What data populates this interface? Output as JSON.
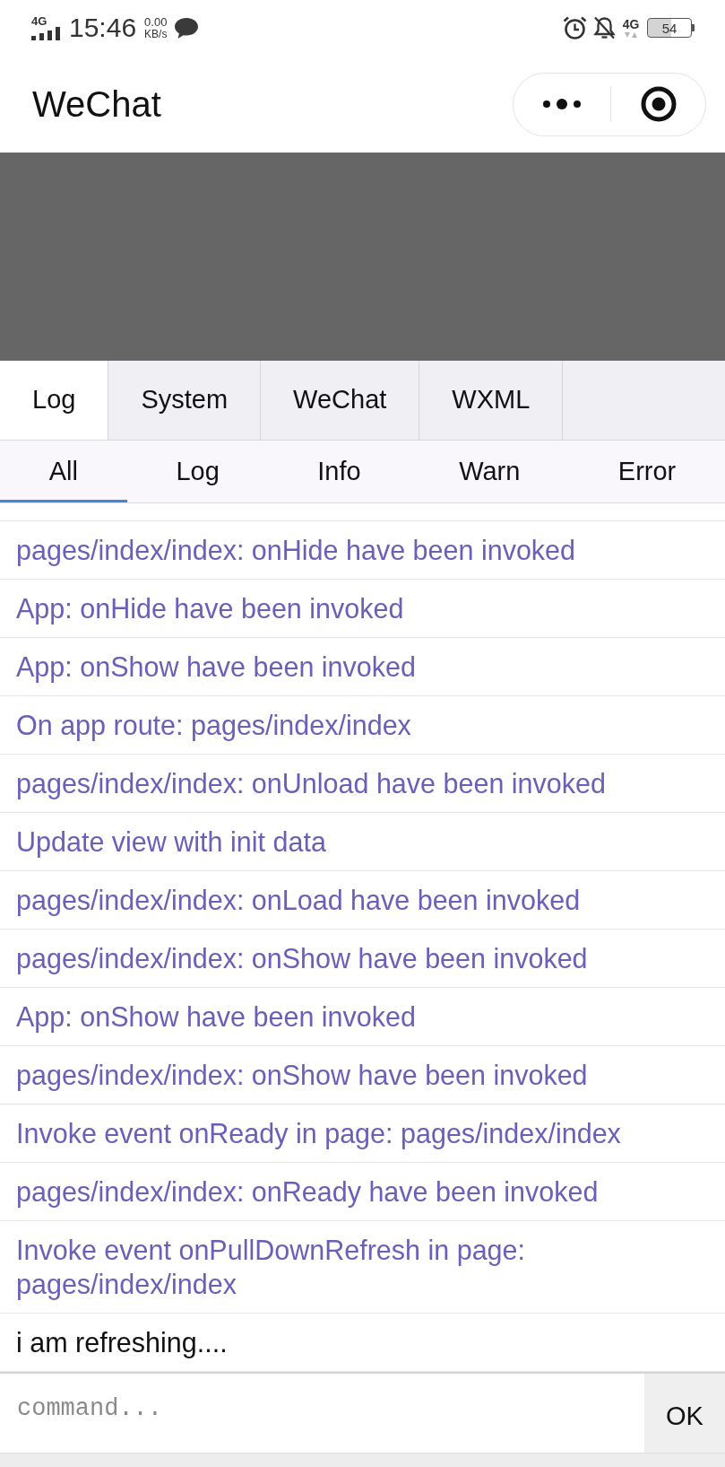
{
  "status_bar": {
    "network": "4G",
    "time": "15:46",
    "speed_value": "0.00",
    "speed_unit": "KB/s",
    "data_network": "4G",
    "battery": "54"
  },
  "title_bar": {
    "title": "WeChat"
  },
  "tabs": [
    {
      "label": "Log",
      "selected": true
    },
    {
      "label": "System",
      "selected": false
    },
    {
      "label": "WeChat",
      "selected": false
    },
    {
      "label": "WXML",
      "selected": false
    }
  ],
  "filters": [
    {
      "label": "All",
      "selected": true
    },
    {
      "label": "Log",
      "selected": false
    },
    {
      "label": "Info",
      "selected": false
    },
    {
      "label": "Warn",
      "selected": false
    },
    {
      "label": "Error",
      "selected": false
    }
  ],
  "log_entries": [
    {
      "kind": "info",
      "text": "pages/index/index: onHide have been invoked"
    },
    {
      "kind": "info",
      "text": "App: onHide have been invoked"
    },
    {
      "kind": "info",
      "text": "App: onShow have been invoked"
    },
    {
      "kind": "info",
      "text": "On app route: pages/index/index"
    },
    {
      "kind": "info",
      "text": "pages/index/index: onUnload have been invoked"
    },
    {
      "kind": "info",
      "text": "Update view with init data"
    },
    {
      "kind": "info",
      "text": "pages/index/index: onLoad have been invoked"
    },
    {
      "kind": "info",
      "text": "pages/index/index: onShow have been invoked"
    },
    {
      "kind": "info",
      "text": "App: onShow have been invoked"
    },
    {
      "kind": "info",
      "text": "pages/index/index: onShow have been invoked"
    },
    {
      "kind": "info",
      "text": "Invoke event onReady in page: pages/index/index"
    },
    {
      "kind": "info",
      "text": "pages/index/index: onReady have been invoked"
    },
    {
      "kind": "info",
      "text": "Invoke event onPullDownRefresh in page: pages/index/index"
    },
    {
      "kind": "log",
      "text": "i am refreshing...."
    }
  ],
  "command": {
    "placeholder": "command...",
    "button": "OK"
  }
}
